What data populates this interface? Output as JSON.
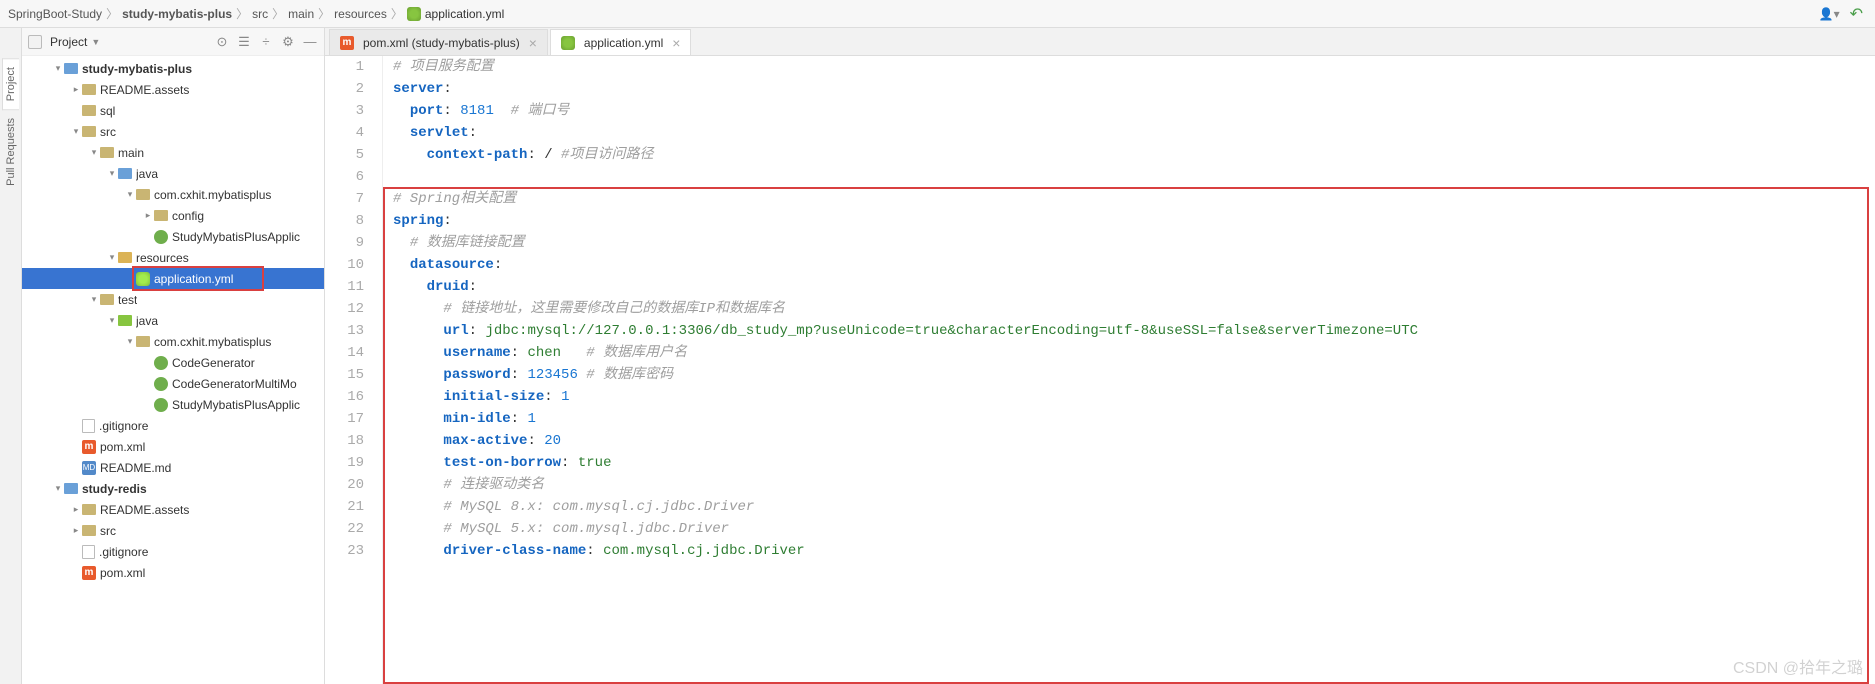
{
  "breadcrumb": [
    "SpringBoot-Study",
    "study-mybatis-plus",
    "src",
    "main",
    "resources",
    "application.yml"
  ],
  "projectPanel": {
    "title": "Project"
  },
  "tree": [
    {
      "indent": 0,
      "arrow": "▾",
      "icon": "module",
      "label": "study-mybatis-plus",
      "bold": true
    },
    {
      "indent": 1,
      "arrow": "▸",
      "icon": "folder",
      "label": "README.assets"
    },
    {
      "indent": 1,
      "arrow": "",
      "icon": "folder",
      "label": "sql"
    },
    {
      "indent": 1,
      "arrow": "▾",
      "icon": "folder",
      "label": "src"
    },
    {
      "indent": 2,
      "arrow": "▾",
      "icon": "folder",
      "label": "main"
    },
    {
      "indent": 3,
      "arrow": "▾",
      "icon": "java",
      "label": "java"
    },
    {
      "indent": 4,
      "arrow": "▾",
      "icon": "pkg",
      "label": "com.cxhit.mybatisplus"
    },
    {
      "indent": 5,
      "arrow": "▸",
      "icon": "pkg",
      "label": "config"
    },
    {
      "indent": 5,
      "arrow": "",
      "icon": "class",
      "label": "StudyMybatisPlusApplic"
    },
    {
      "indent": 3,
      "arrow": "▾",
      "icon": "res",
      "label": "resources"
    },
    {
      "indent": 4,
      "arrow": "",
      "icon": "yaml",
      "label": "application.yml",
      "selected": true,
      "highlight": true
    },
    {
      "indent": 2,
      "arrow": "▾",
      "icon": "folder",
      "label": "test"
    },
    {
      "indent": 3,
      "arrow": "▾",
      "icon": "test",
      "label": "java"
    },
    {
      "indent": 4,
      "arrow": "▾",
      "icon": "pkg",
      "label": "com.cxhit.mybatisplus"
    },
    {
      "indent": 5,
      "arrow": "",
      "icon": "class",
      "label": "CodeGenerator"
    },
    {
      "indent": 5,
      "arrow": "",
      "icon": "class",
      "label": "CodeGeneratorMultiMo"
    },
    {
      "indent": 5,
      "arrow": "",
      "icon": "class",
      "label": "StudyMybatisPlusApplic"
    },
    {
      "indent": 1,
      "arrow": "",
      "icon": "file",
      "label": ".gitignore"
    },
    {
      "indent": 1,
      "arrow": "",
      "icon": "maven",
      "label": "pom.xml"
    },
    {
      "indent": 1,
      "arrow": "",
      "icon": "md",
      "label": "README.md"
    },
    {
      "indent": 0,
      "arrow": "▾",
      "icon": "module",
      "label": "study-redis",
      "bold": true
    },
    {
      "indent": 1,
      "arrow": "▸",
      "icon": "folder",
      "label": "README.assets"
    },
    {
      "indent": 1,
      "arrow": "▸",
      "icon": "folder",
      "label": "src"
    },
    {
      "indent": 1,
      "arrow": "",
      "icon": "file",
      "label": ".gitignore"
    },
    {
      "indent": 1,
      "arrow": "",
      "icon": "maven",
      "label": "pom.xml"
    }
  ],
  "tabs": [
    {
      "icon": "maven",
      "label": "pom.xml (study-mybatis-plus)",
      "active": false
    },
    {
      "icon": "yaml",
      "label": "application.yml",
      "active": true
    }
  ],
  "code": {
    "lines": [
      {
        "n": 1,
        "t": [
          {
            "c": "cmt",
            "v": "# 项目服务配置"
          }
        ]
      },
      {
        "n": 2,
        "t": [
          {
            "c": "key",
            "v": "server"
          },
          {
            "c": "txt",
            "v": ":"
          }
        ]
      },
      {
        "n": 3,
        "t": [
          {
            "c": "txt",
            "v": "  "
          },
          {
            "c": "key",
            "v": "port"
          },
          {
            "c": "txt",
            "v": ": "
          },
          {
            "c": "num",
            "v": "8181"
          },
          {
            "c": "txt",
            "v": "  "
          },
          {
            "c": "cmt",
            "v": "# 端口号"
          }
        ]
      },
      {
        "n": 4,
        "t": [
          {
            "c": "txt",
            "v": "  "
          },
          {
            "c": "key",
            "v": "servlet"
          },
          {
            "c": "txt",
            "v": ":"
          }
        ]
      },
      {
        "n": 5,
        "t": [
          {
            "c": "txt",
            "v": "    "
          },
          {
            "c": "key",
            "v": "context-path"
          },
          {
            "c": "txt",
            "v": ": / "
          },
          {
            "c": "cmt",
            "v": "#项目访问路径"
          }
        ]
      },
      {
        "n": 6,
        "t": []
      },
      {
        "n": 7,
        "t": [
          {
            "c": "cmt",
            "v": "# Spring相关配置"
          }
        ]
      },
      {
        "n": 8,
        "t": [
          {
            "c": "key",
            "v": "spring"
          },
          {
            "c": "txt",
            "v": ":"
          }
        ]
      },
      {
        "n": 9,
        "t": [
          {
            "c": "txt",
            "v": "  "
          },
          {
            "c": "cmt",
            "v": "# 数据库链接配置"
          }
        ]
      },
      {
        "n": 10,
        "t": [
          {
            "c": "txt",
            "v": "  "
          },
          {
            "c": "key",
            "v": "datasource"
          },
          {
            "c": "txt",
            "v": ":"
          }
        ]
      },
      {
        "n": 11,
        "t": [
          {
            "c": "txt",
            "v": "    "
          },
          {
            "c": "key",
            "v": "druid"
          },
          {
            "c": "txt",
            "v": ":"
          }
        ]
      },
      {
        "n": 12,
        "t": [
          {
            "c": "txt",
            "v": "      "
          },
          {
            "c": "cmt",
            "v": "# 链接地址，这里需要修改自己的数据库IP和数据库名"
          }
        ]
      },
      {
        "n": 13,
        "t": [
          {
            "c": "txt",
            "v": "      "
          },
          {
            "c": "key",
            "v": "url"
          },
          {
            "c": "txt",
            "v": ": "
          },
          {
            "c": "val",
            "v": "jdbc:mysql://127.0.0.1:3306/db_study_mp?useUnicode=true&characterEncoding=utf-8&useSSL=false&serverTimezone=UTC"
          }
        ]
      },
      {
        "n": 14,
        "t": [
          {
            "c": "txt",
            "v": "      "
          },
          {
            "c": "key",
            "v": "username"
          },
          {
            "c": "txt",
            "v": ": "
          },
          {
            "c": "val",
            "v": "chen"
          },
          {
            "c": "txt",
            "v": "   "
          },
          {
            "c": "cmt",
            "v": "# 数据库用户名"
          }
        ]
      },
      {
        "n": 15,
        "t": [
          {
            "c": "txt",
            "v": "      "
          },
          {
            "c": "key",
            "v": "password"
          },
          {
            "c": "txt",
            "v": ": "
          },
          {
            "c": "num",
            "v": "123456"
          },
          {
            "c": "txt",
            "v": " "
          },
          {
            "c": "cmt",
            "v": "# 数据库密码"
          }
        ]
      },
      {
        "n": 16,
        "t": [
          {
            "c": "txt",
            "v": "      "
          },
          {
            "c": "key",
            "v": "initial-size"
          },
          {
            "c": "txt",
            "v": ": "
          },
          {
            "c": "num",
            "v": "1"
          }
        ]
      },
      {
        "n": 17,
        "t": [
          {
            "c": "txt",
            "v": "      "
          },
          {
            "c": "key",
            "v": "min-idle"
          },
          {
            "c": "txt",
            "v": ": "
          },
          {
            "c": "num",
            "v": "1"
          }
        ]
      },
      {
        "n": 18,
        "t": [
          {
            "c": "txt",
            "v": "      "
          },
          {
            "c": "key",
            "v": "max-active"
          },
          {
            "c": "txt",
            "v": ": "
          },
          {
            "c": "num",
            "v": "20"
          }
        ]
      },
      {
        "n": 19,
        "t": [
          {
            "c": "txt",
            "v": "      "
          },
          {
            "c": "key",
            "v": "test-on-borrow"
          },
          {
            "c": "txt",
            "v": ": "
          },
          {
            "c": "val",
            "v": "true"
          }
        ]
      },
      {
        "n": 20,
        "t": [
          {
            "c": "txt",
            "v": "      "
          },
          {
            "c": "cmt",
            "v": "# 连接驱动类名"
          }
        ]
      },
      {
        "n": 21,
        "t": [
          {
            "c": "txt",
            "v": "      "
          },
          {
            "c": "cmt",
            "v": "# MySQL 8.x: com.mysql.cj.jdbc.Driver"
          }
        ]
      },
      {
        "n": 22,
        "t": [
          {
            "c": "txt",
            "v": "      "
          },
          {
            "c": "cmt",
            "v": "# MySQL 5.x: com.mysql.jdbc.Driver"
          }
        ]
      },
      {
        "n": 23,
        "t": [
          {
            "c": "txt",
            "v": "      "
          },
          {
            "c": "key",
            "v": "driver-class-name"
          },
          {
            "c": "txt",
            "v": ": "
          },
          {
            "c": "val",
            "v": "com.mysql.cj.jdbc.Driver"
          }
        ]
      }
    ]
  },
  "watermark": "CSDN @拾年之璐"
}
